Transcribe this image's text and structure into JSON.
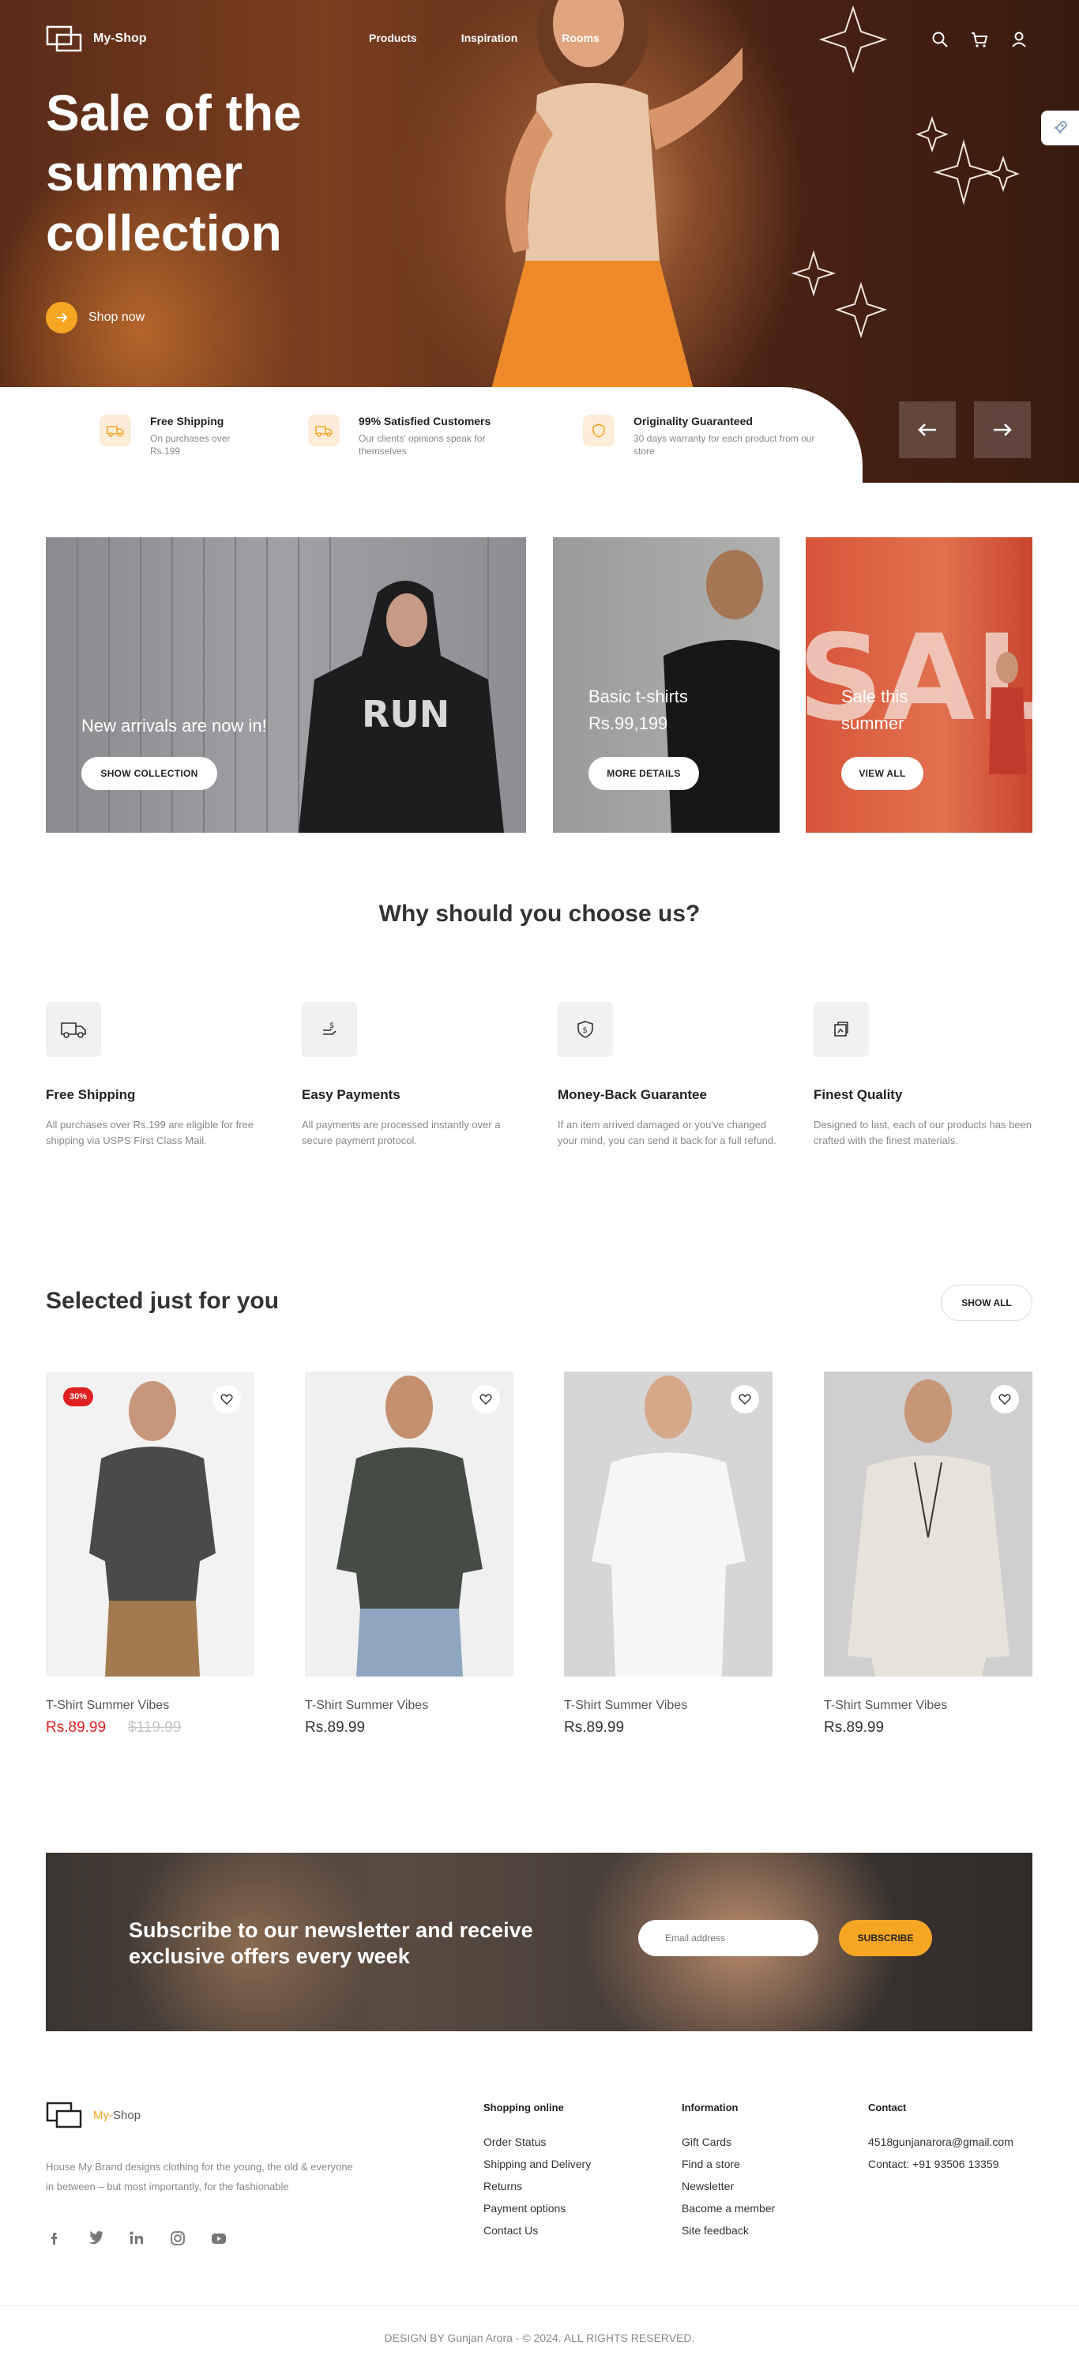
{
  "brand": {
    "name": "My-Shop",
    "footer_part1": "My-",
    "footer_part2": "Shop"
  },
  "nav": {
    "links": [
      "Products",
      "Inspiration",
      "Rooms"
    ],
    "icons": [
      "search-icon",
      "cart-icon",
      "user-icon"
    ]
  },
  "hero": {
    "title": "Sale of the summer collection",
    "cta": "Shop now"
  },
  "strip": [
    {
      "title": "Free Shipping",
      "desc": "On purchases over Rs.199",
      "icon": "truck-icon"
    },
    {
      "title": "99% Satisfied Customers",
      "desc": "Our clients' opinions speak for themselves",
      "icon": "truck-icon"
    },
    {
      "title": "Originality Guaranteed",
      "desc": "30 days warranty for each product from our store",
      "icon": "shield-icon"
    }
  ],
  "promos": [
    {
      "text": "New arrivals are now in!",
      "button": "SHOW COLLECTION",
      "image_overlay": "RUN"
    },
    {
      "text": "Basic t-shirts Rs.99,199",
      "button": "MORE DETAILS"
    },
    {
      "text": "Sale this summer",
      "button": "VIEW ALL",
      "image_overlay": "SAL"
    }
  ],
  "why": {
    "title": "Why should you choose us?",
    "items": [
      {
        "title": "Free Shipping",
        "desc": "All purchases over Rs.199 are eligible for free shipping via USPS First Class Mail.",
        "icon": "truck-icon"
      },
      {
        "title": "Easy Payments",
        "desc": "All payments are processed instantly over a secure payment protocol.",
        "icon": "payment-icon"
      },
      {
        "title": "Money-Back Guarantee",
        "desc": "If an item arrived damaged or you've changed your mind, you can send it back for a full refund.",
        "icon": "shield-dollar-icon"
      },
      {
        "title": "Finest Quality",
        "desc": "Designed to last, each of our products has been crafted with the finest materials.",
        "icon": "quality-icon"
      }
    ]
  },
  "selected": {
    "title": "Selected just for you",
    "show_all": "SHOW ALL",
    "products": [
      {
        "name": "T-Shirt Summer Vibes",
        "price": "Rs.89.99",
        "old_price": "$119.99",
        "badge": "30%",
        "shirt": "#4a4a48",
        "bg": "#f2f2f2"
      },
      {
        "name": "T-Shirt Summer Vibes",
        "price": "Rs.89.99",
        "shirt": "#454b45",
        "bg": "#f0f0f0"
      },
      {
        "name": "T-Shirt Summer Vibes",
        "price": "Rs.89.99",
        "shirt": "#f6f6f4",
        "bg": "#d6d6d6"
      },
      {
        "name": "T-Shirt Summer Vibes",
        "price": "Rs.89.99",
        "shirt": "#e8e3da",
        "bg": "#cfcfcf"
      }
    ]
  },
  "newsletter": {
    "title": "Subscribe to our newsletter and receive exclusive offers every week",
    "placeholder": "Email address",
    "button": "SUBSCRIBE"
  },
  "footer": {
    "desc": "House My Brand designs clothing for the young, the old & everyone in between – but most importantly, for the fashionable",
    "socials": [
      "facebook-icon",
      "twitter-icon",
      "linkedin-icon",
      "instagram-icon",
      "youtube-icon"
    ],
    "columns": [
      {
        "title": "Shopping online",
        "links": [
          "Order Status",
          "Shipping and Delivery",
          "Returns",
          "Payment options",
          "Contact Us"
        ]
      },
      {
        "title": "Information",
        "links": [
          "Gift Cards",
          "Find a store",
          "Newsletter",
          "Bacome a member",
          "Site feedback"
        ]
      },
      {
        "title": "Contact",
        "links": [
          "4518gunjanarora@gmail.com",
          "Contact: +91 93506 13359"
        ]
      }
    ],
    "copyright": "DESIGN BY Gunjan Arora - © 2024. ALL RIGHTS RESERVED."
  },
  "colors": {
    "accent": "#f6a623",
    "sale": "#e02020",
    "hero_bg": "#4a2314"
  }
}
